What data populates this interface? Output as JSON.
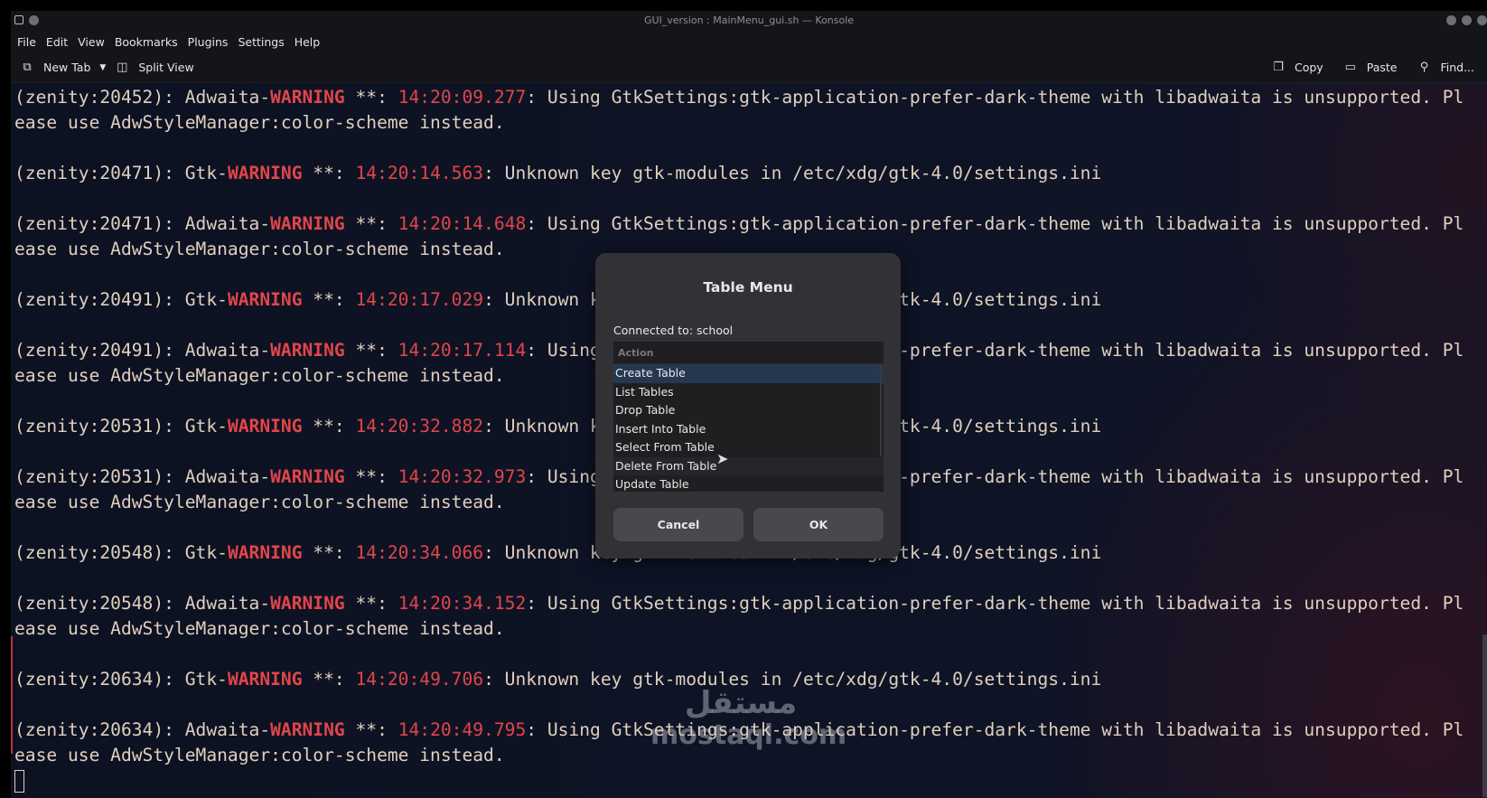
{
  "window": {
    "title": "GUI_version : MainMenu_gui.sh — Konsole"
  },
  "menubar": [
    "File",
    "Edit",
    "View",
    "Bookmarks",
    "Plugins",
    "Settings",
    "Help"
  ],
  "toolbar": {
    "new_tab": "New Tab",
    "split_view": "Split View",
    "copy": "Copy",
    "paste": "Paste",
    "find": "Find..."
  },
  "terminal": {
    "entries": [
      {
        "prefix": "(zenity:20452): Adwaita-",
        "level": "WARNING",
        "sep": " **: ",
        "time": "14:20:09.277",
        "msg": ": Using GtkSettings:gtk-application-prefer-dark-theme with libadwaita is unsupported. Pl",
        "cont": "ease use AdwStyleManager:color-scheme instead."
      },
      {
        "prefix": "(zenity:20471): Gtk-",
        "level": "WARNING",
        "sep": " **: ",
        "time": "14:20:14.563",
        "msg": ": Unknown key gtk-modules in /etc/xdg/gtk-4.0/settings.ini"
      },
      {
        "prefix": "(zenity:20471): Adwaita-",
        "level": "WARNING",
        "sep": " **: ",
        "time": "14:20:14.648",
        "msg": ": Using GtkSettings:gtk-application-prefer-dark-theme with libadwaita is unsupported. Pl",
        "cont": "ease use AdwStyleManager:color-scheme instead."
      },
      {
        "prefix": "(zenity:20491): Gtk-",
        "level": "WARNING",
        "sep": " **: ",
        "time": "14:20:17.029",
        "msg": ": Unknown key gtk-modules in /etc/xdg/gtk-4.0/settings.ini"
      },
      {
        "prefix": "(zenity:20491): Adwaita-",
        "level": "WARNING",
        "sep": " **: ",
        "time": "14:20:17.114",
        "msg": ": Using GtkSettings:gtk-application-prefer-dark-theme with libadwaita is unsupported. Pl",
        "cont": "ease use AdwStyleManager:color-scheme instead."
      },
      {
        "prefix": "(zenity:20531): Gtk-",
        "level": "WARNING",
        "sep": " **: ",
        "time": "14:20:32.882",
        "msg": ": Unknown key gtk-modules in /etc/xdg/gtk-4.0/settings.ini"
      },
      {
        "prefix": "(zenity:20531): Adwaita-",
        "level": "WARNING",
        "sep": " **: ",
        "time": "14:20:32.973",
        "msg": ": Using GtkSettings:gtk-application-prefer-dark-theme with libadwaita is unsupported. Pl",
        "cont": "ease use AdwStyleManager:color-scheme instead."
      },
      {
        "prefix": "(zenity:20548): Gtk-",
        "level": "WARNING",
        "sep": " **: ",
        "time": "14:20:34.066",
        "msg": ": Unknown key gtk-modules in /etc/xdg/gtk-4.0/settings.ini"
      },
      {
        "prefix": "(zenity:20548): Adwaita-",
        "level": "WARNING",
        "sep": " **: ",
        "time": "14:20:34.152",
        "msg": ": Using GtkSettings:gtk-application-prefer-dark-theme with libadwaita is unsupported. Pl",
        "cont": "ease use AdwStyleManager:color-scheme instead."
      },
      {
        "prefix": "(zenity:20634): Gtk-",
        "level": "WARNING",
        "sep": " **: ",
        "time": "14:20:49.706",
        "msg": ": Unknown key gtk-modules in /etc/xdg/gtk-4.0/settings.ini"
      },
      {
        "prefix": "(zenity:20634): Adwaita-",
        "level": "WARNING",
        "sep": " **: ",
        "time": "14:20:49.795",
        "msg": ": Using GtkSettings:gtk-application-prefer-dark-theme with libadwaita is unsupported. Pl",
        "cont": "ease use AdwStyleManager:color-scheme instead."
      }
    ]
  },
  "dialog": {
    "title": "Table Menu",
    "connected": "Connected to: school",
    "column_header": "Action",
    "items": [
      "Create Table",
      "List Tables",
      "Drop Table",
      "Insert Into Table",
      "Select From Table",
      "Delete From Table",
      "Update Table"
    ],
    "selected_index": 0,
    "cancel": "Cancel",
    "ok": "OK"
  },
  "watermark": {
    "arabic": "مستقل",
    "latin": "mostaql.com"
  },
  "colors": {
    "warning": "#e2454a",
    "text": "#e0d0bd",
    "selection": "#263850"
  }
}
